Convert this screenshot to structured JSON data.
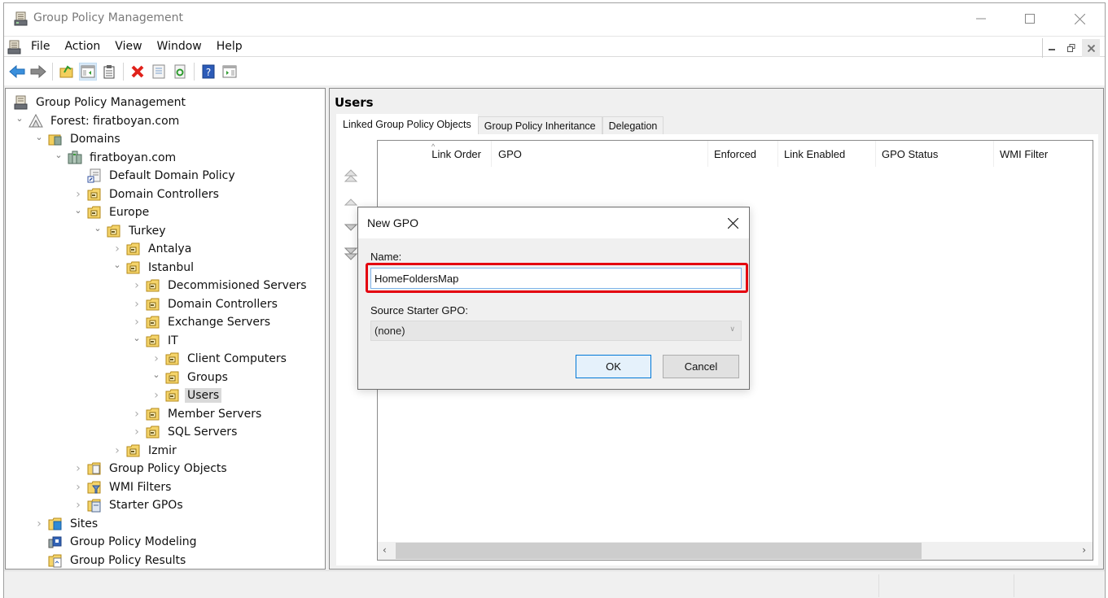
{
  "window": {
    "title": "Group Policy Management"
  },
  "menubar": {
    "items": [
      "File",
      "Action",
      "View",
      "Window",
      "Help"
    ]
  },
  "toolbar": {
    "buttons": [
      {
        "icon": "back-arrow-icon",
        "label": "Back"
      },
      {
        "icon": "forward-arrow-icon",
        "label": "Forward"
      },
      {
        "icon": "up-folder-icon",
        "label": "Up one level"
      },
      {
        "icon": "show-hide-console-tree-icon",
        "label": "Show/Hide Console Tree"
      },
      {
        "icon": "clipboard-icon",
        "label": "Paste"
      },
      {
        "icon": "delete-icon",
        "label": "Delete"
      },
      {
        "icon": "properties-icon",
        "label": "Properties"
      },
      {
        "icon": "refresh-icon",
        "label": "Refresh"
      },
      {
        "icon": "help-icon",
        "label": "Help"
      },
      {
        "icon": "show-hide-action-pane-icon",
        "label": "Show/Hide Action Pane"
      }
    ]
  },
  "tree": {
    "items": [
      {
        "label": "Group Policy Management",
        "level": 0,
        "expander": "none",
        "icon": "gpmc-icon"
      },
      {
        "label": "Forest: firatboyan.com",
        "level": 1,
        "expander": "expanded",
        "icon": "forest-icon"
      },
      {
        "label": "Domains",
        "level": 2,
        "expander": "expanded",
        "icon": "domains-folder-icon"
      },
      {
        "label": "firatboyan.com",
        "level": 3,
        "expander": "expanded",
        "icon": "domain-icon"
      },
      {
        "label": "Default Domain Policy",
        "level": 4,
        "expander": "none",
        "icon": "gpo-link-icon"
      },
      {
        "label": "Domain Controllers",
        "level": 4,
        "expander": "collapsed",
        "icon": "ou-folder-icon"
      },
      {
        "label": "Europe",
        "level": 4,
        "expander": "expanded",
        "icon": "ou-folder-icon"
      },
      {
        "label": "Turkey",
        "level": 5,
        "expander": "expanded",
        "icon": "ou-folder-icon"
      },
      {
        "label": "Antalya",
        "level": 6,
        "expander": "collapsed",
        "icon": "ou-folder-icon"
      },
      {
        "label": "Istanbul",
        "level": 6,
        "expander": "expanded",
        "icon": "ou-folder-icon"
      },
      {
        "label": "Decommisioned Servers",
        "level": 7,
        "expander": "collapsed",
        "icon": "ou-folder-icon"
      },
      {
        "label": "Domain Controllers",
        "level": 7,
        "expander": "collapsed",
        "icon": "ou-folder-icon"
      },
      {
        "label": "Exchange Servers",
        "level": 7,
        "expander": "collapsed",
        "icon": "ou-folder-icon"
      },
      {
        "label": "IT",
        "level": 7,
        "expander": "expanded",
        "icon": "ou-folder-icon"
      },
      {
        "label": "Client Computers",
        "level": 8,
        "expander": "collapsed",
        "icon": "ou-folder-icon"
      },
      {
        "label": "Groups",
        "level": 8,
        "expander": "expanded",
        "icon": "ou-folder-icon"
      },
      {
        "label": "Users",
        "level": 8,
        "expander": "collapsed",
        "icon": "ou-folder-icon",
        "selected": true
      },
      {
        "label": "Member Servers",
        "level": 7,
        "expander": "collapsed",
        "icon": "ou-folder-icon"
      },
      {
        "label": "SQL Servers",
        "level": 7,
        "expander": "collapsed",
        "icon": "ou-folder-icon"
      },
      {
        "label": "Izmir",
        "level": 6,
        "expander": "collapsed",
        "icon": "ou-folder-icon"
      },
      {
        "label": "Group Policy Objects",
        "level": 4,
        "expander": "collapsed",
        "icon": "gpo-folder-icon"
      },
      {
        "label": "WMI Filters",
        "level": 4,
        "expander": "collapsed",
        "icon": "wmi-filter-folder-icon"
      },
      {
        "label": "Starter GPOs",
        "level": 4,
        "expander": "collapsed",
        "icon": "starter-gpo-folder-icon"
      },
      {
        "label": "Sites",
        "level": 2,
        "expander": "collapsed",
        "icon": "sites-folder-icon"
      },
      {
        "label": "Group Policy Modeling",
        "level": 2,
        "expander": "none",
        "icon": "modeling-icon"
      },
      {
        "label": "Group Policy Results",
        "level": 2,
        "expander": "none",
        "icon": "results-icon"
      }
    ]
  },
  "details": {
    "title": "Users",
    "tabs": [
      {
        "label": "Linked Group Policy Objects",
        "active": true
      },
      {
        "label": "Group Policy Inheritance",
        "active": false
      },
      {
        "label": "Delegation",
        "active": false
      }
    ],
    "columns": [
      "Link Order",
      "GPO",
      "Enforced",
      "Link Enabled",
      "GPO Status",
      "WMI Filter"
    ],
    "sorted_column": "Link Order",
    "rows": []
  },
  "dialog": {
    "title": "New GPO",
    "name_label": "Name:",
    "name_value": "HomeFoldersMap",
    "source_label": "Source Starter GPO:",
    "source_value": "(none)",
    "ok_label": "OK",
    "cancel_label": "Cancel",
    "highlight_color": "#e4000f"
  }
}
